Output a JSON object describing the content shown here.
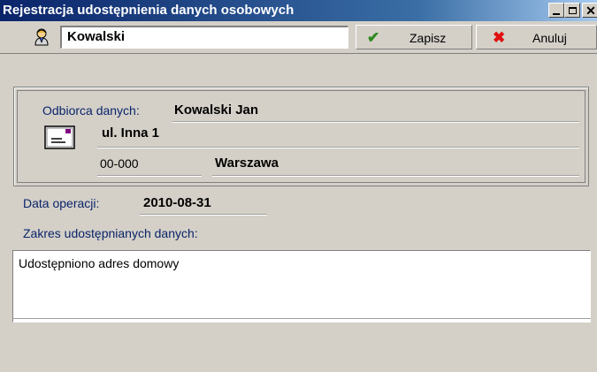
{
  "window": {
    "title": "Rejestracja udostępnienia danych osobowych"
  },
  "toolbar": {
    "name_value": "Kowalski",
    "save_label": "Zapisz",
    "cancel_label": "Anuluj"
  },
  "recipient": {
    "label": "Odbiorca danych:",
    "name": "Kowalski Jan",
    "street": "ul. Inna 1",
    "postal_code": "00-000",
    "city": "Warszawa"
  },
  "operation": {
    "date_label": "Data operacji:",
    "date_value": "2010-08-31",
    "scope_label": "Zakres udostępnianych danych:",
    "scope_value": "Udostępniono adres domowy"
  },
  "icons": {
    "person": "person-icon",
    "envelope": "envelope-icon",
    "save": "checkmark-icon",
    "cancel": "x-icon"
  },
  "colors": {
    "titlebar_start": "#0a246a",
    "label_text": "#0a246a",
    "save_check": "#2e8b1e",
    "cancel_x": "#e01010"
  }
}
